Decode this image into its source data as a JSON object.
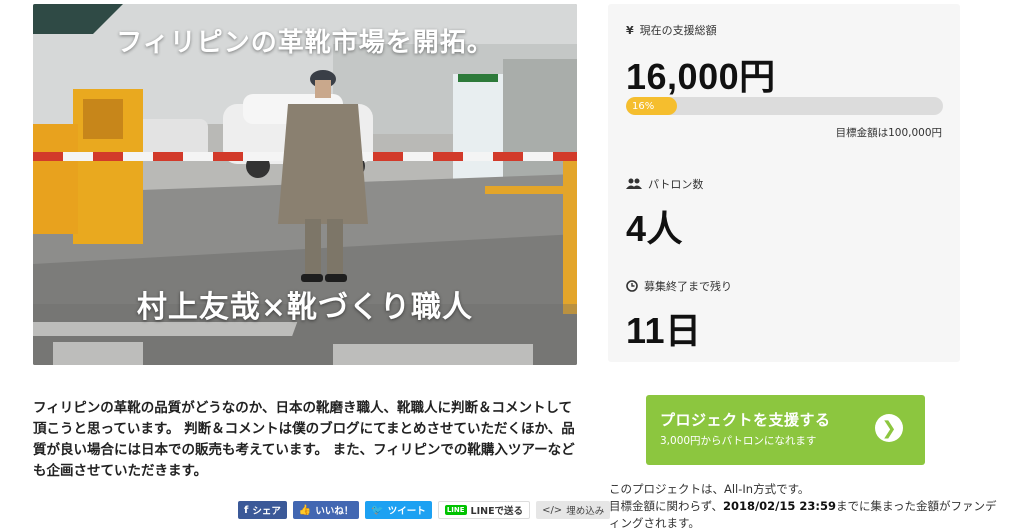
{
  "hero": {
    "title": "フィリピンの革靴市場を開拓。",
    "subtitle": "村上友哉×靴づくり職人"
  },
  "description": "フィリピンの革靴の品質がどうなのか、日本の靴磨き職人、靴職人に判断＆コメントして頂こうと思っています。 判断＆コメントは僕のブログにてまとめさせていただくほか、品質が良い場合には日本での販売も考えています。 また、フィリピンでの靴購入ツアーなども企画させていただきます。",
  "share": {
    "facebook": "シェア",
    "like": "いいね！",
    "tweet": "ツイート",
    "line_badge": "LINE",
    "line": "LINEで送る",
    "embed": "埋め込み"
  },
  "stats": {
    "raised_icon": "yen-icon",
    "raised_label": "現在の支援総額",
    "raised_value": "16,000円",
    "progress_percent": 16,
    "progress_text": "16%",
    "goal": "目標金額は100,000円",
    "backers_icon": "users-icon",
    "backers_label": "パトロン数",
    "backers_value": "4人",
    "remaining_icon": "clock-icon",
    "remaining_label": "募集終了まで残り",
    "remaining_value": "11日"
  },
  "cta": {
    "label": "プロジェクトを支援する",
    "sublabel": "3,000円からパトロンになれます",
    "arrow": "❯"
  },
  "note": {
    "line1": "このプロジェクトは、All-In方式です。",
    "line2_pre": "目標金額に関わらず、",
    "line2_date": "2018/02/15 23:59",
    "line2_post": "までに集まった金額がファンディングされます。"
  },
  "colors": {
    "accent_green": "#8cc63f",
    "progress_yellow": "#f5be2e",
    "panel_bg": "#f6f6f6"
  }
}
